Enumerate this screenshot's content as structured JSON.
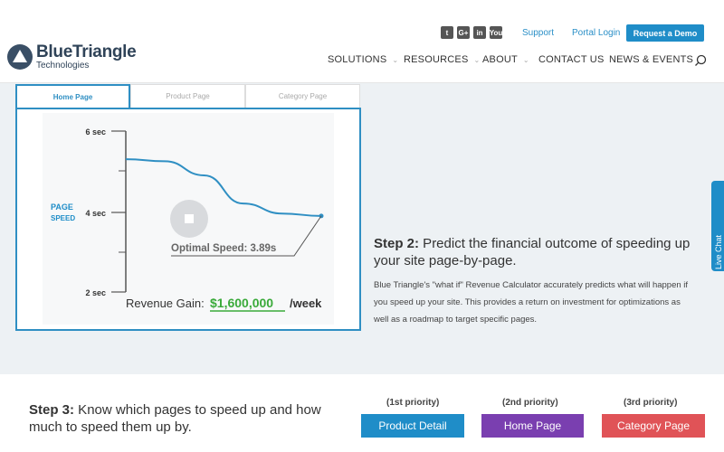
{
  "header": {
    "logo_name": "BlueTriangle",
    "logo_sub": "Technologies",
    "social_icons": [
      "twitter-icon",
      "google-plus-icon",
      "linkedin-icon",
      "youtube-icon"
    ],
    "social_glyphs": [
      "t",
      "G+",
      "in",
      "You"
    ],
    "support": "Support",
    "portal_login": "Portal Login",
    "demo": "Request a Demo",
    "nav": [
      "SOLUTIONS",
      "RESOURCES",
      "ABOUT",
      "CONTACT US",
      "NEWS & EVENTS"
    ]
  },
  "section2": {
    "tabs": [
      "Home Page",
      "Product Page",
      "Category Page"
    ],
    "active_tab": "Home Page",
    "chart": {
      "ylabel_line1": "PAGE",
      "ylabel_line2": "SPEED",
      "ticks": [
        "6 sec",
        "4 sec",
        "2 sec"
      ],
      "optimal": "Optimal Speed: 3.89s",
      "revenue_label": "Revenue Gain:",
      "revenue_value": "$1,600,000",
      "revenue_unit": "/week"
    },
    "chart_data": {
      "type": "line",
      "ylabel": "PAGE SPEED",
      "ylim": [
        2,
        6
      ],
      "y_ticks": [
        6,
        4,
        2
      ],
      "series": [
        {
          "values": [
            5.3,
            5.25,
            4.9,
            4.2,
            3.95,
            3.89
          ]
        }
      ],
      "annotations": [
        "Optimal Speed: 3.89s",
        "Revenue Gain: $1,600,000 /week"
      ]
    },
    "step_prefix": "Step 2:",
    "step_title": " Predict the financial outcome of speeding up your site page-by-page.",
    "body": "Blue Triangle's \"what if\" Revenue Calculator accurately predicts what will happen if you speed up your site. This provides a return on investment for optimizations as well as a roadmap to target specific pages.",
    "live_chat": "Live Chat"
  },
  "section3": {
    "step_prefix": "Step 3:",
    "step_title": " Know which pages to speed up and how much to speed them up by.",
    "priorities": [
      {
        "label": "(1st priority)",
        "button": "Product Detail",
        "color": "#1f8dc8"
      },
      {
        "label": "(2nd priority)",
        "button": "Home Page",
        "color": "#7a3fb0"
      },
      {
        "label": "(3rd priority)",
        "button": "Category Page",
        "color": "#e05357"
      }
    ]
  }
}
